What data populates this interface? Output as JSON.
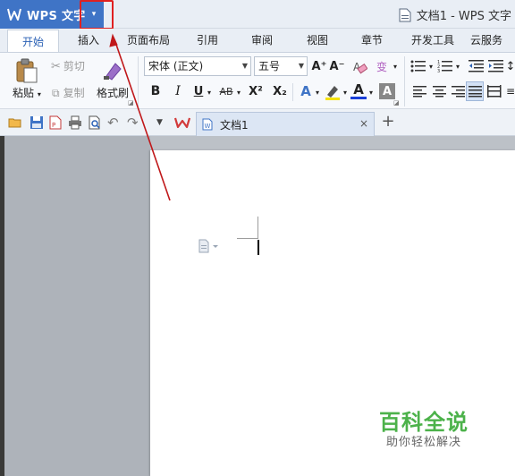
{
  "app": {
    "name": "WPS 文字",
    "dropdown_glyph": "▾",
    "window_title": "文档1 - WPS 文字"
  },
  "menu": {
    "tabs": [
      {
        "label": "开始",
        "active": true
      },
      {
        "label": "插入"
      },
      {
        "label": "页面布局"
      },
      {
        "label": "引用"
      },
      {
        "label": "审阅"
      },
      {
        "label": "视图"
      },
      {
        "label": "章节"
      },
      {
        "label": "开发工具"
      },
      {
        "label": "云服务"
      }
    ]
  },
  "ribbon": {
    "paste_label": "粘贴",
    "cut_label": "剪切",
    "copy_label": "复制",
    "format_painter_label": "格式刷",
    "font_name": "宋体 (正文)",
    "font_size": "五号",
    "bold": "B",
    "italic": "I",
    "underline": "U",
    "strikethrough": "AB",
    "superscript": "X²",
    "subscript": "X₂",
    "grow_font": "A⁺",
    "shrink_font": "A⁻",
    "text_effect": "A",
    "font_color": "A",
    "char_shading": "A",
    "phonetic": "变",
    "accent_color": "#3f74c6"
  },
  "tabs": {
    "document_tab": "文档1",
    "close_glyph": "×",
    "new_tab_glyph": "+"
  },
  "watermark": {
    "title": "百科全说",
    "subtitle": "助你轻松解决"
  }
}
